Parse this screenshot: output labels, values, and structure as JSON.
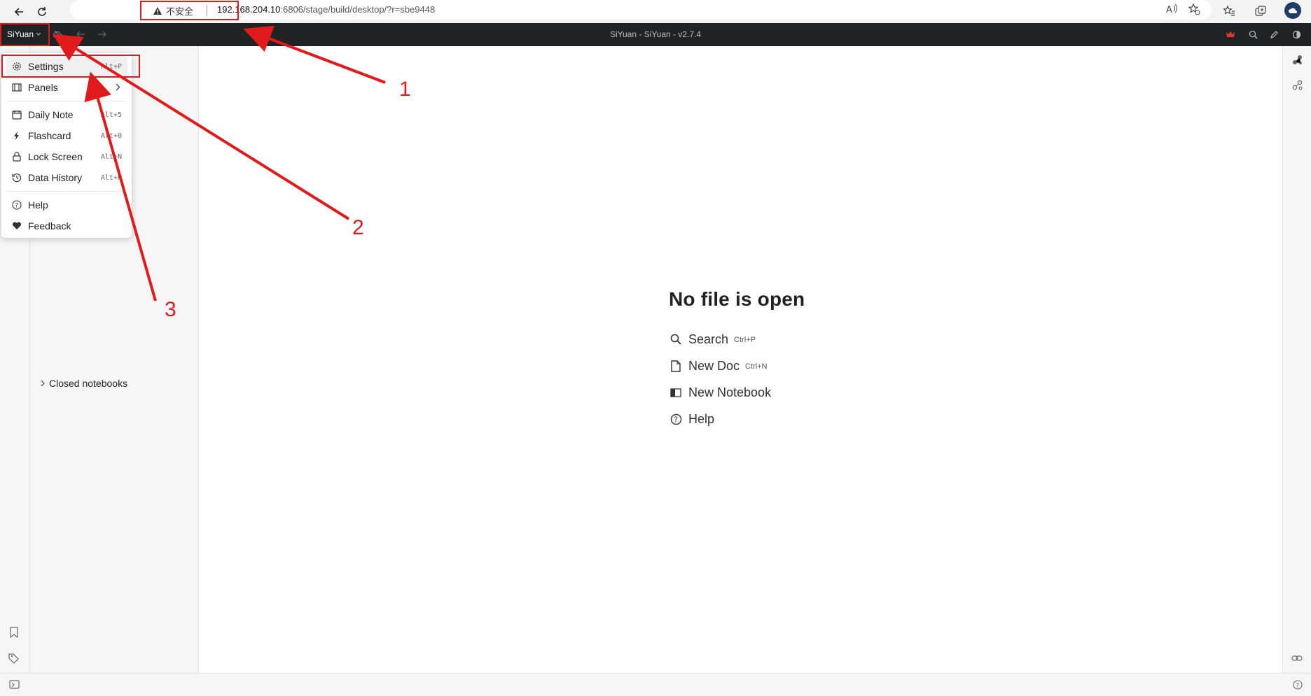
{
  "browser": {
    "security_label": "不安全",
    "url_host": "192.168.204.10",
    "url_port": ":6806",
    "url_path": "/stage/build/desktop/?r=sbe9448"
  },
  "toolbar": {
    "brand_label": "SiYuan",
    "window_title": "SiYuan - SiYuan - v2.7.4"
  },
  "menu": {
    "items": [
      {
        "label": "Settings",
        "shortcut": "Alt+P",
        "icon": "gear-icon"
      },
      {
        "label": "Panels",
        "icon": "panel-icon"
      },
      {
        "label": "Daily Note",
        "shortcut": "Alt+5",
        "icon": "calendar-icon"
      },
      {
        "label": "Flashcard",
        "shortcut": "Alt+0",
        "icon": "bolt-icon"
      },
      {
        "label": "Lock Screen",
        "shortcut": "Alt+N",
        "icon": "lock-icon"
      },
      {
        "label": "Data History",
        "shortcut": "Alt+H",
        "icon": "history-icon"
      },
      {
        "label": "Help",
        "icon": "help-icon"
      },
      {
        "label": "Feedback",
        "icon": "heart-icon"
      }
    ]
  },
  "filetree": {
    "closed_notebooks": "Closed notebooks"
  },
  "empty_state": {
    "title": "No file is open",
    "actions": [
      {
        "label": "Search",
        "shortcut": "Ctrl+P",
        "icon": "search-icon"
      },
      {
        "label": "New Doc",
        "shortcut": "Ctrl+N",
        "icon": "doc-icon"
      },
      {
        "label": "New Notebook",
        "icon": "notebook-icon"
      },
      {
        "label": "Help",
        "icon": "help-icon"
      }
    ]
  },
  "annotations": {
    "labels": [
      "1",
      "2",
      "3"
    ],
    "color": "#e11b1b"
  },
  "colors": {
    "toolbar_bg": "#212224",
    "pane_bg": "#f6f6f7",
    "accent_red": "#e11b1b"
  }
}
